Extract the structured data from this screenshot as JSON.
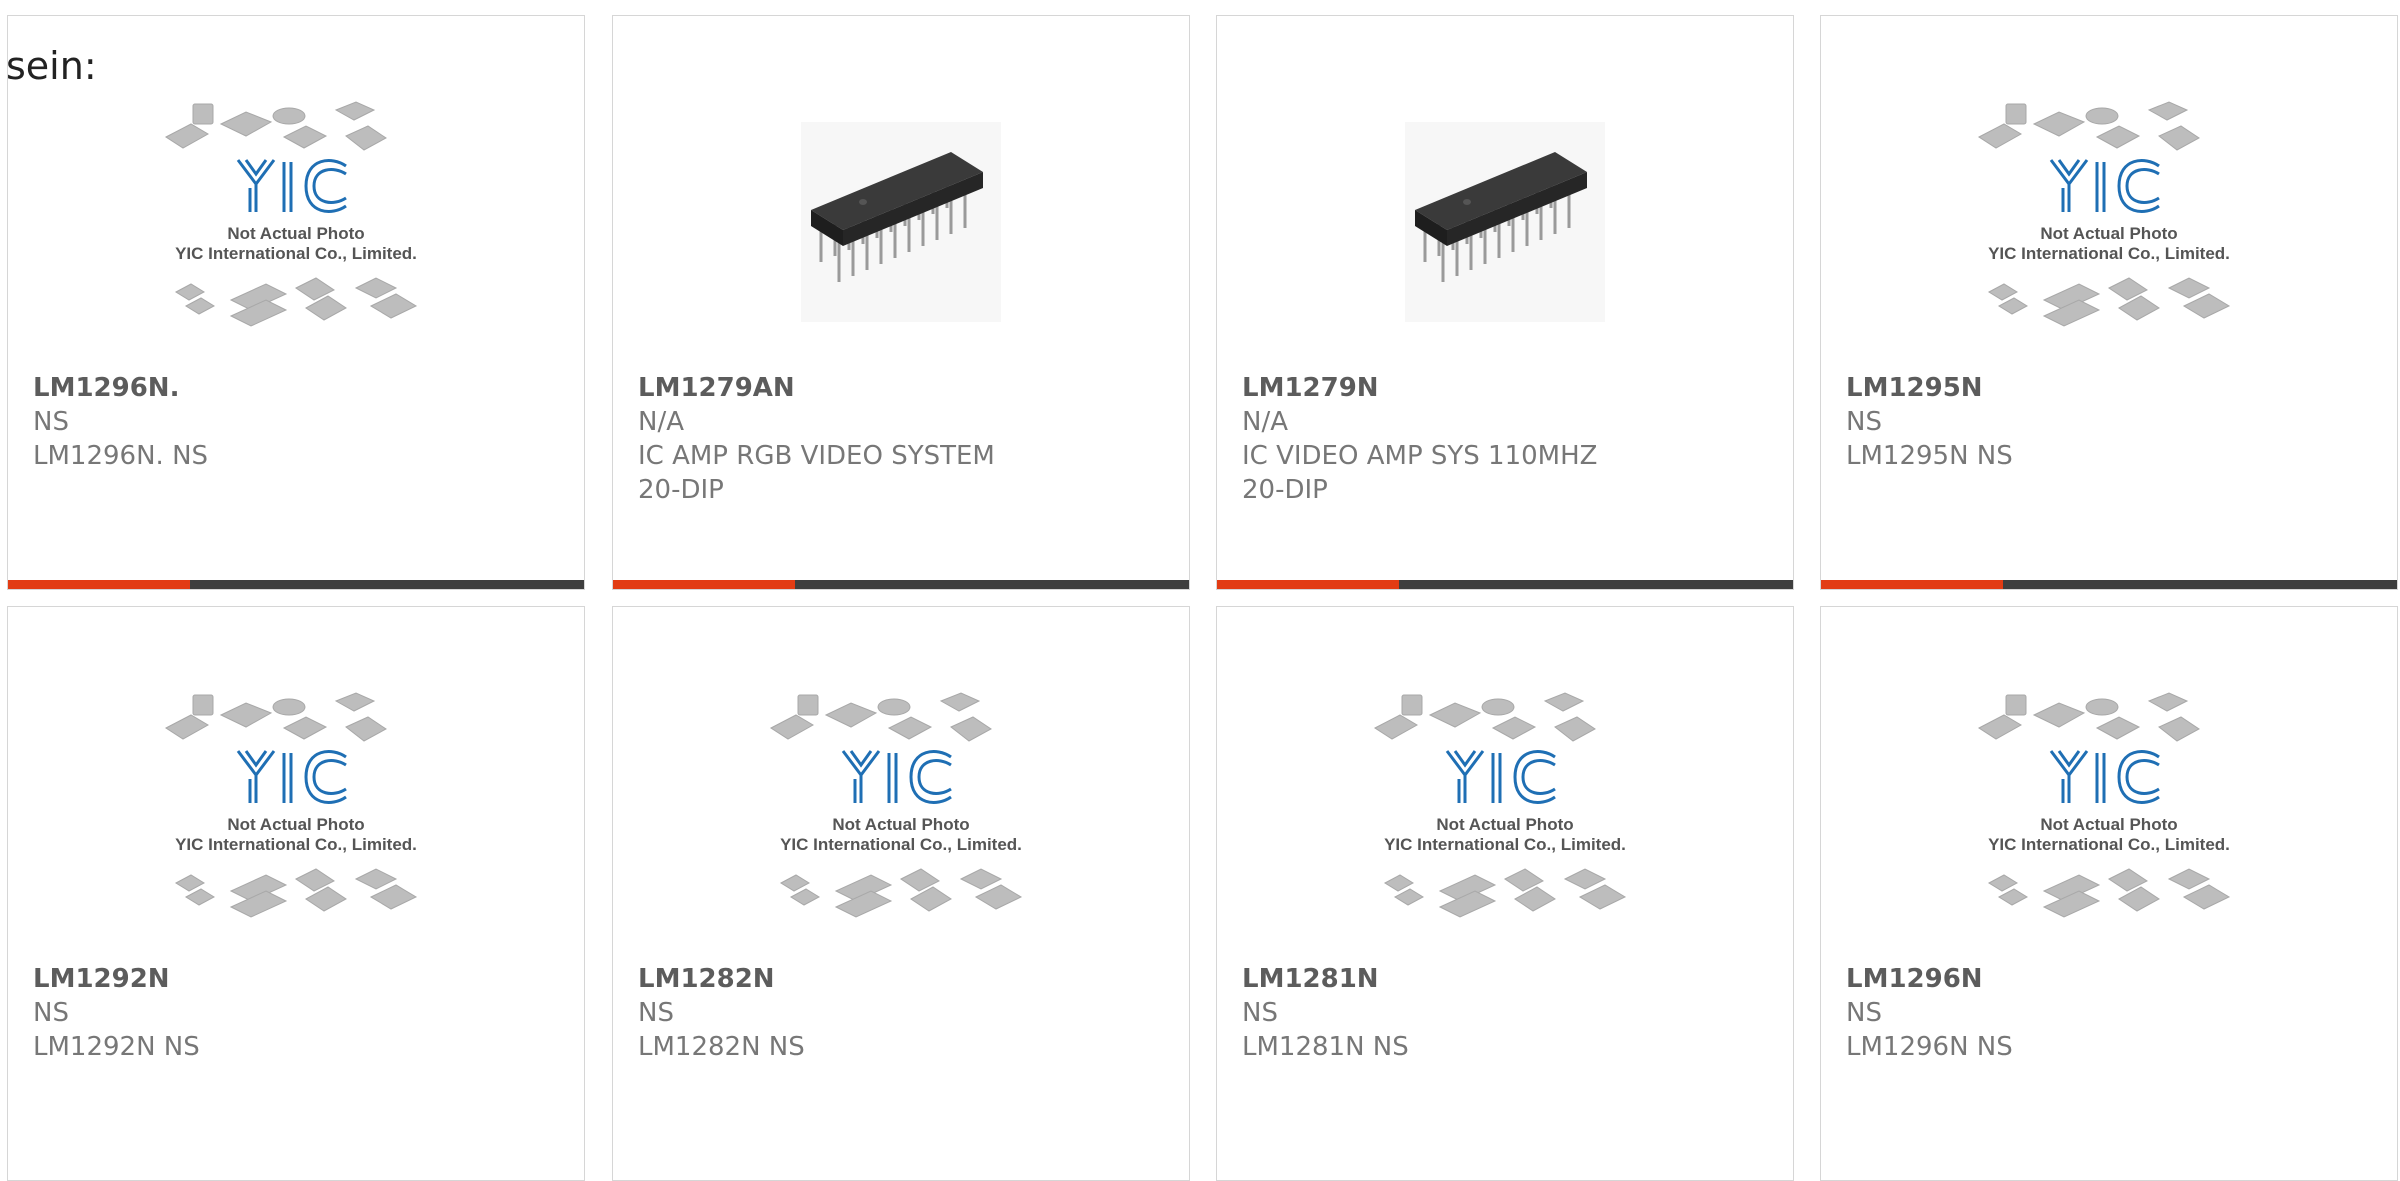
{
  "intro": "sein:",
  "placeholder_logo": {
    "brand": "YIC",
    "line1": "Not Actual Photo",
    "line2": "YIC International Co., Limited."
  },
  "colors": {
    "accent": "#e23c14",
    "bar": "#3e3e3e",
    "logo_blue": "#1f6fb4"
  },
  "products": [
    {
      "part": "LM1296N.",
      "mfr": "NS",
      "desc": "LM1296N. NS",
      "image": "placeholder"
    },
    {
      "part": "LM1279AN",
      "mfr": "N/A",
      "desc": "IC AMP RGB VIDEO SYSTEM 20-DIP",
      "image": "chip"
    },
    {
      "part": "LM1279N",
      "mfr": "N/A",
      "desc": "IC VIDEO AMP SYS 110MHZ 20-DIP",
      "image": "chip"
    },
    {
      "part": "LM1295N",
      "mfr": "NS",
      "desc": "LM1295N NS",
      "image": "placeholder"
    },
    {
      "part": "LM1292N",
      "mfr": "NS",
      "desc": "LM1292N NS",
      "image": "placeholder"
    },
    {
      "part": "LM1282N",
      "mfr": "NS",
      "desc": "LM1282N NS",
      "image": "placeholder"
    },
    {
      "part": "LM1281N",
      "mfr": "NS",
      "desc": "LM1281N NS",
      "image": "placeholder"
    },
    {
      "part": "LM1296N",
      "mfr": "NS",
      "desc": "LM1296N NS",
      "image": "placeholder"
    }
  ]
}
